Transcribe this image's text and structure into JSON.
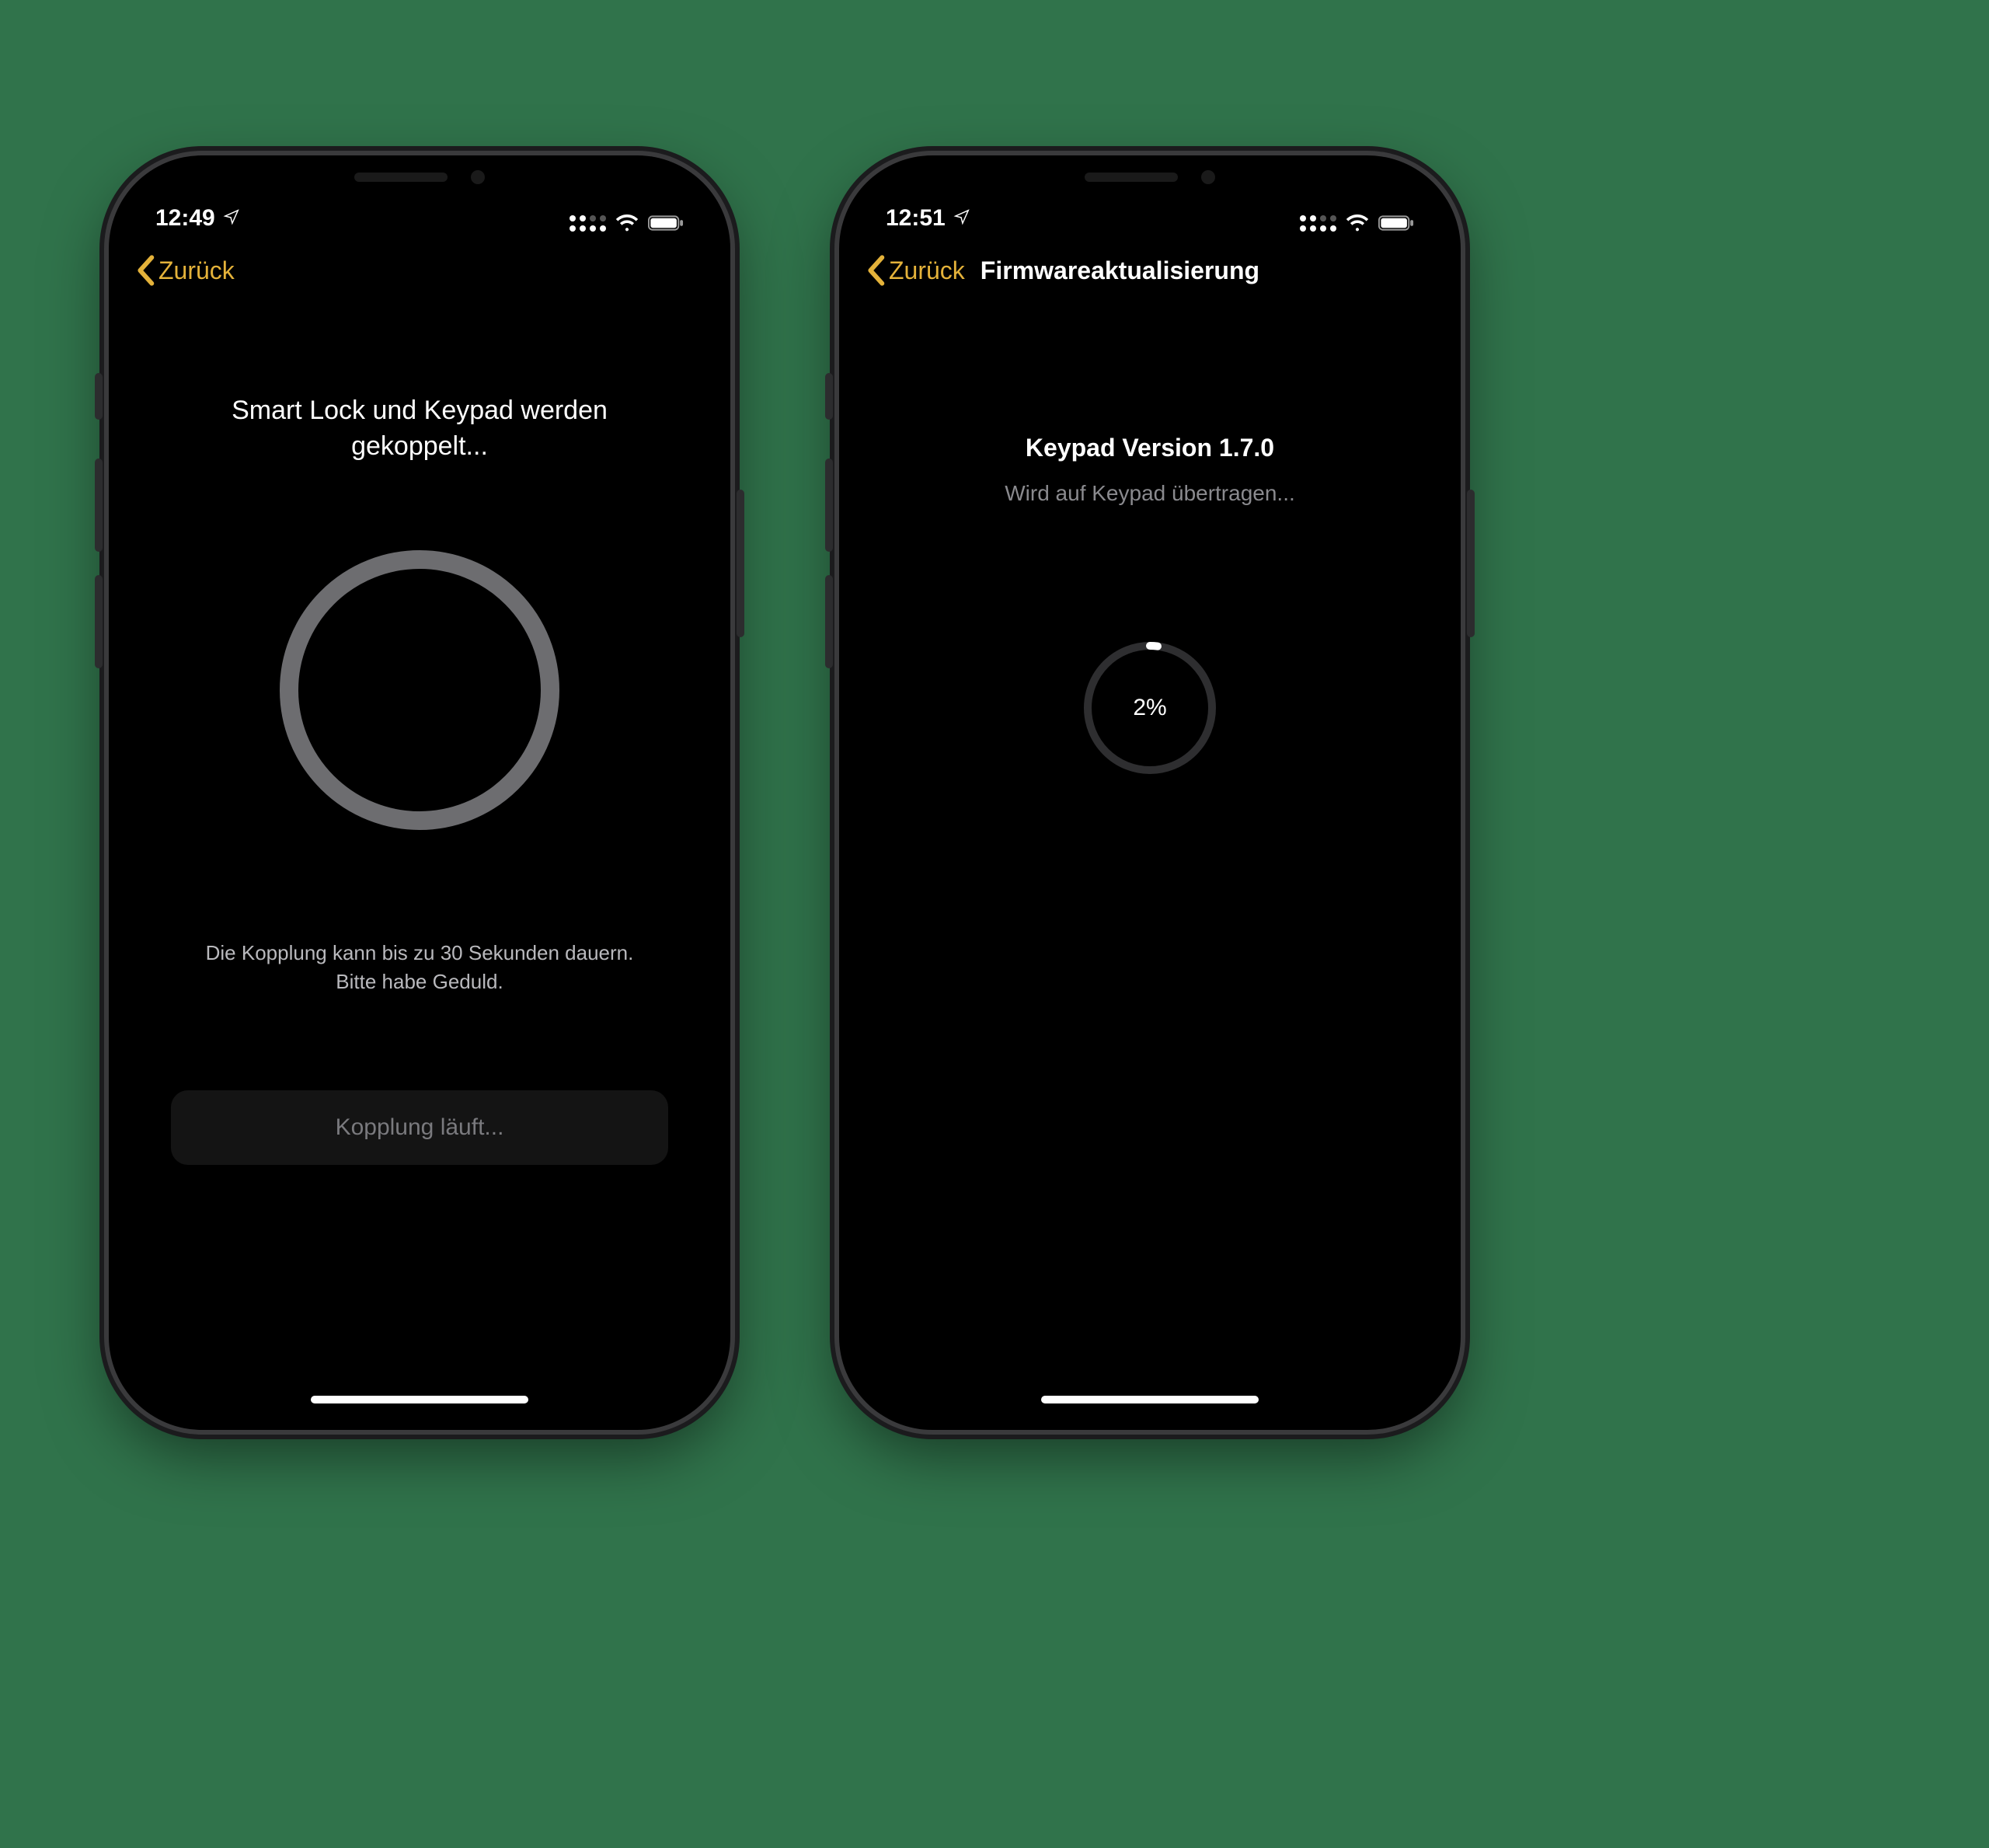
{
  "colors": {
    "accent": "#e4b23a",
    "bg": "#000000",
    "stage_bg": "#30734b",
    "muted_text": "#8a8a8e",
    "ring": "#6d6d70",
    "button_bg": "#141414",
    "button_text": "#7a7a7e"
  },
  "left": {
    "status": {
      "time": "12:49"
    },
    "nav": {
      "back_label": "Zurück"
    },
    "headline": "Smart Lock und Keypad werden gekoppelt...",
    "hint": "Die Kopplung kann bis zu 30 Sekunden dauern. Bitte habe Geduld.",
    "button_label": "Kopplung läuft..."
  },
  "right": {
    "status": {
      "time": "12:51"
    },
    "nav": {
      "back_label": "Zurück",
      "title": "Firmwareaktualisierung"
    },
    "fw_title": "Keypad Version 1.7.0",
    "fw_sub": "Wird auf Keypad übertragen...",
    "progress": {
      "percent": 2,
      "label": "2%"
    }
  }
}
